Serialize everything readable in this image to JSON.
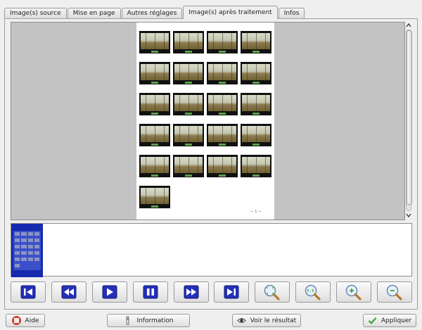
{
  "tabs": [
    {
      "label": "Image(s) source",
      "active": false
    },
    {
      "label": "Mise en page",
      "active": false
    },
    {
      "label": "Autres réglages",
      "active": false
    },
    {
      "label": "Image(s) après traitement",
      "active": true
    },
    {
      "label": "Infos",
      "active": false
    }
  ],
  "preview": {
    "page_number": "— 1 —",
    "thumbnail_count": 21
  },
  "controls": [
    {
      "name": "first-icon"
    },
    {
      "name": "rewind-icon"
    },
    {
      "name": "play-icon"
    },
    {
      "name": "pause-icon"
    },
    {
      "name": "fast-forward-icon"
    },
    {
      "name": "last-icon"
    },
    {
      "name": "zoom-fit-icon"
    },
    {
      "name": "zoom-1to1-icon"
    },
    {
      "name": "zoom-in-icon"
    },
    {
      "name": "zoom-out-icon"
    }
  ],
  "bottom": {
    "help_label": "Aide",
    "info_label": "Information",
    "view_label": "Voir le résultat",
    "apply_label": "Appliquer"
  },
  "colors": {
    "control_blue": "#2430b8",
    "selection_blue": "#142bb0",
    "zoom_green": "#3aa63a"
  }
}
